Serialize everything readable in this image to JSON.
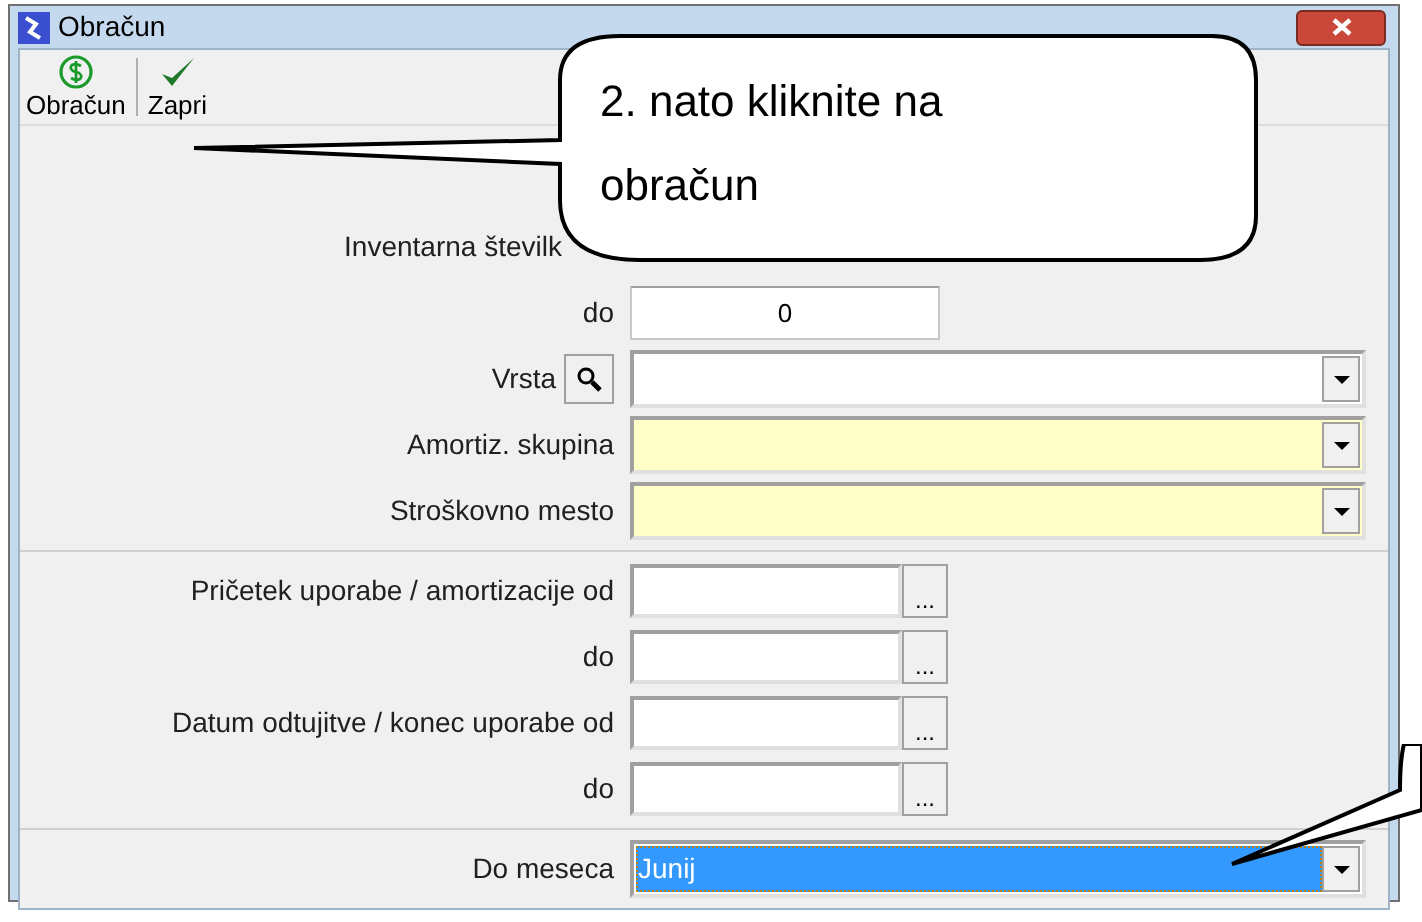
{
  "window": {
    "title": "Obračun"
  },
  "toolbar": [
    {
      "label": "Obračun",
      "kind": "calc"
    },
    {
      "label": "Zapri",
      "kind": "check"
    }
  ],
  "sections": [
    {
      "rows": [
        {
          "label": "Inventarna številk",
          "kind": "covered"
        },
        {
          "label": "do",
          "kind": "text",
          "value": "0"
        },
        {
          "label": "Vrsta",
          "kind": "combo",
          "lookup": true,
          "required": false,
          "focused": false
        },
        {
          "label": "Amortiz. skupina",
          "kind": "combo",
          "lookup": false,
          "required": true,
          "focused": false
        },
        {
          "label": "Stroškovno mesto",
          "kind": "combo",
          "lookup": false,
          "required": true,
          "focused": false
        }
      ]
    },
    {
      "rows": [
        {
          "label": "Pričetek uporabe / amortizacije od",
          "kind": "date",
          "browse": "..."
        },
        {
          "label": "do",
          "kind": "date",
          "browse": "..."
        },
        {
          "label": "Datum odtujitve / konec uporabe od",
          "kind": "date",
          "browse": "..."
        },
        {
          "label": "do",
          "kind": "date",
          "browse": "..."
        }
      ]
    },
    {
      "rows": [
        {
          "label": "Do meseca",
          "kind": "combo",
          "lookup": false,
          "required": false,
          "focused": true,
          "value": "Junij"
        }
      ]
    }
  ],
  "callout": {
    "text": "2. nato kliknite na obračun"
  }
}
